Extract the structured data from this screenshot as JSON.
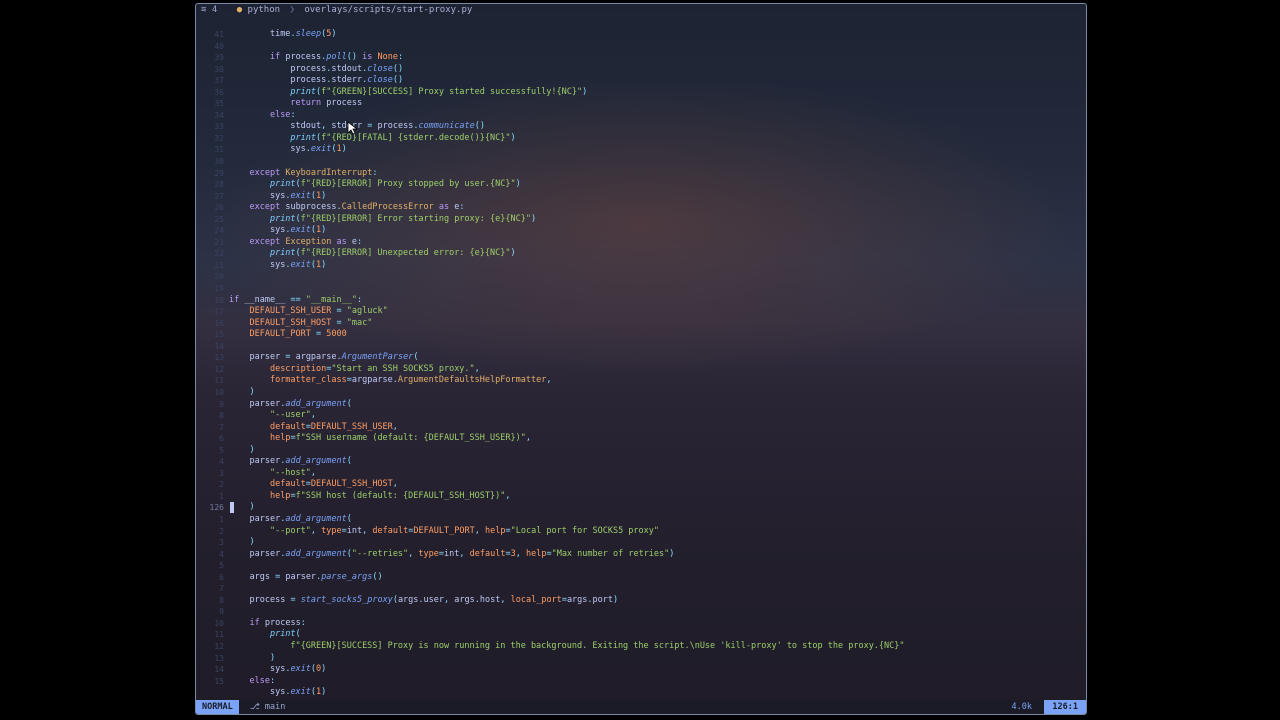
{
  "winbar": {
    "buffer_number": "4",
    "language": "python",
    "path": "overlays/scripts/start-proxy.py"
  },
  "statusline": {
    "mode": "NORMAL",
    "branch": "main",
    "file_size": "4.0k",
    "position": "126:1"
  },
  "line_numbers": [
    "41",
    "40",
    "39",
    "38",
    "37",
    "36",
    "35",
    "34",
    "33",
    "32",
    "31",
    "30",
    "29",
    "28",
    "27",
    "26",
    "25",
    "24",
    "23",
    "22",
    "21",
    "20",
    "19",
    "18",
    "17",
    "16",
    "15",
    "14",
    "13",
    "12",
    "11",
    "10",
    "9",
    "8",
    "7",
    "6",
    "5",
    "4",
    "3",
    "2",
    "1",
    "126",
    "1",
    "2",
    "3",
    "4",
    "5",
    "6",
    "7",
    "8",
    "9",
    "10",
    "11",
    "12",
    "13",
    "14",
    "15"
  ],
  "code_lines": [
    "        time.sleep(5)",
    "",
    "        if process.poll() is None:",
    "            process.stdout.close()",
    "            process.stderr.close()",
    "            print(f\"{GREEN}[SUCCESS] Proxy started successfully!{NC}\")",
    "            return process",
    "        else:",
    "            stdout, stderr = process.communicate()",
    "            print(f\"{RED}[FATAL] {stderr.decode()}{NC}\")",
    "            sys.exit(1)",
    "",
    "    except KeyboardInterrupt:",
    "        print(f\"{RED}[ERROR] Proxy stopped by user.{NC}\")",
    "        sys.exit(1)",
    "    except subprocess.CalledProcessError as e:",
    "        print(f\"{RED}[ERROR] Error starting proxy: {e}{NC}\")",
    "        sys.exit(1)",
    "    except Exception as e:",
    "        print(f\"{RED}[ERROR] Unexpected error: {e}{NC}\")",
    "        sys.exit(1)",
    "",
    "",
    "if __name__ == \"__main__\":",
    "    DEFAULT_SSH_USER = \"agluck\"",
    "    DEFAULT_SSH_HOST = \"mac\"",
    "    DEFAULT_PORT = 5000",
    "",
    "    parser = argparse.ArgumentParser(",
    "        description=\"Start an SSH SOCKS5 proxy.\",",
    "        formatter_class=argparse.ArgumentDefaultsHelpFormatter,",
    "    )",
    "    parser.add_argument(",
    "        \"--user\",",
    "        default=DEFAULT_SSH_USER,",
    "        help=f\"SSH username (default: {DEFAULT_SSH_USER})\",",
    "    )",
    "    parser.add_argument(",
    "        \"--host\",",
    "        default=DEFAULT_SSH_HOST,",
    "        help=f\"SSH host (default: {DEFAULT_SSH_HOST})\",",
    "    )",
    "    parser.add_argument(",
    "        \"--port\", type=int, default=DEFAULT_PORT, help=\"Local port for SOCKS5 proxy\"",
    "    )",
    "    parser.add_argument(\"--retries\", type=int, default=3, help=\"Max number of retries\")",
    "",
    "    args = parser.parse_args()",
    "",
    "    process = start_socks5_proxy(args.user, args.host, local_port=args.port)",
    "",
    "    if process:",
    "        print(",
    "            f\"{GREEN}[SUCCESS] Proxy is now running in the background. Exiting the script.\\nUse 'kill-proxy' to stop the proxy.{NC}\"",
    "        )",
    "        sys.exit(0)",
    "    else:",
    "        sys.exit(1)"
  ],
  "current_line_index": 41,
  "icons": {
    "buffer": "layers-icon",
    "language": "python-icon",
    "branch": "git-branch-icon",
    "mouse": "mouse-pointer-icon"
  },
  "colors": {
    "accent": "#7aa2f7",
    "keyword": "#bb9af7",
    "string": "#9ece6a",
    "number": "#ff9e64"
  }
}
